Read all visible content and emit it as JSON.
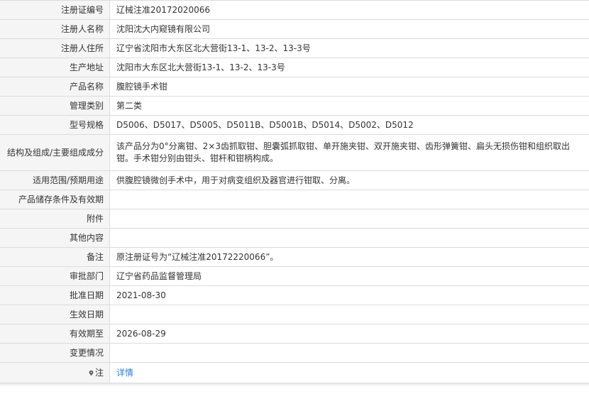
{
  "rows": [
    {
      "label": "注册证编号",
      "value": "辽械注准20172020066"
    },
    {
      "label": "注册人名称",
      "value": "沈阳沈大内窥镜有限公司"
    },
    {
      "label": "注册人住所",
      "value": "辽宁省沈阳市大东区北大营街13-1、13-2、13-3号"
    },
    {
      "label": "生产地址",
      "value": "沈阳市大东区北大营街13-1、13-2、13-3号"
    },
    {
      "label": "产品名称",
      "value": "腹腔镜手术钳"
    },
    {
      "label": "管理类别",
      "value": "第二类"
    },
    {
      "label": "型号规格",
      "value": "D5006、D5017、D5005、D5011B、D5001B、D5014、D5002、D5012"
    },
    {
      "label": "结构及组成/主要组成成分",
      "value": "该产品分为0°分离钳、2×3齿抓取钳、胆囊弧抓取钳、单开施夹钳、双开施夹钳、齿形弹簧钳、扁头无损伤钳和组织取出钳。手术钳分别由钳头、钳杆和钳柄构成。"
    },
    {
      "label": "适用范围/预期用途",
      "value": "供腹腔镜微创手术中，用于对病变组织及器官进行钳取、分离。"
    },
    {
      "label": "产品储存条件及有效期",
      "value": ""
    },
    {
      "label": "附件",
      "value": ""
    },
    {
      "label": "其他内容",
      "value": ""
    },
    {
      "label": "备注",
      "value": "原注册证号为“辽械注准20172220066”。"
    },
    {
      "label": "审批部门",
      "value": "辽宁省药品监督管理局"
    },
    {
      "label": "批准日期",
      "value": "2021-08-30"
    },
    {
      "label": "生效日期",
      "value": ""
    },
    {
      "label": "有效期至",
      "value": "2026-08-29"
    },
    {
      "label": "变更情况",
      "value": ""
    }
  ],
  "note_row": {
    "label": "注",
    "icon": "pin-icon",
    "link_text": "详情"
  },
  "colors": {
    "label_bg": "#f5f5f5",
    "border": "#dcdcdc",
    "link": "#2a7ed3",
    "text": "#333333"
  }
}
